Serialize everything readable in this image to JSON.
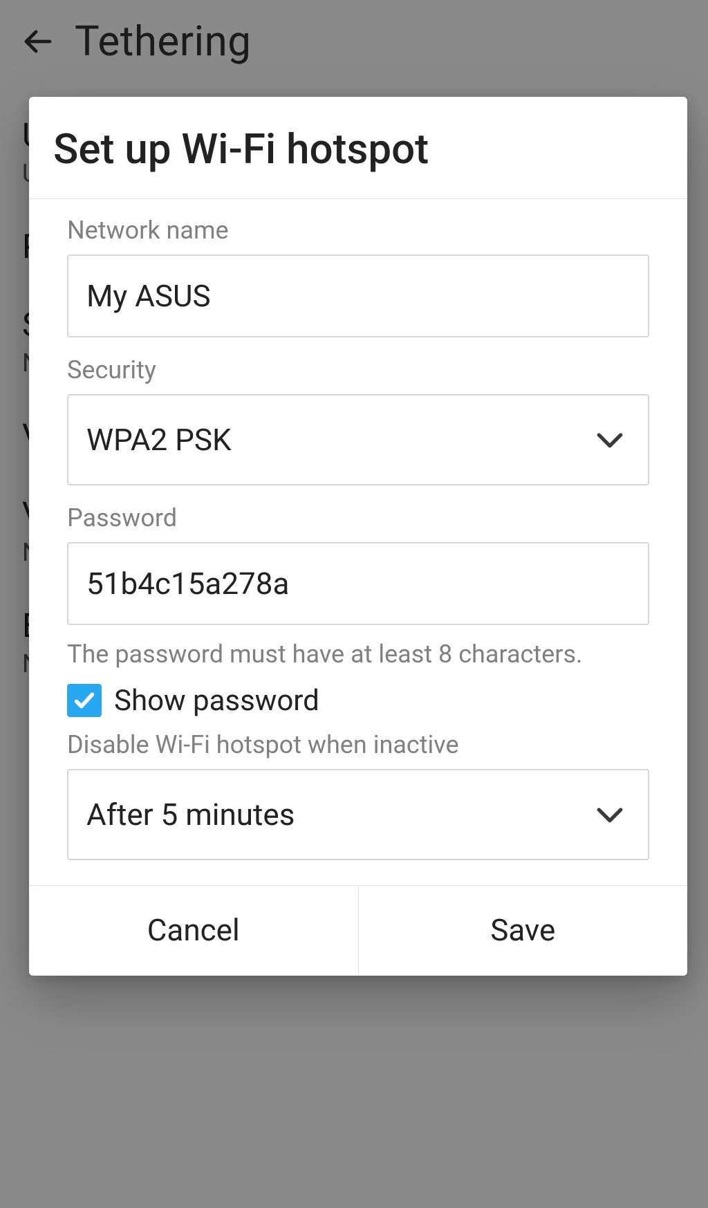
{
  "header": {
    "title": "Tethering"
  },
  "background_items": [
    {
      "title": "U",
      "sub": "U"
    },
    {
      "title": "P",
      "sub": ""
    },
    {
      "title": "S",
      "sub": "N"
    },
    {
      "title": "V",
      "sub": ""
    },
    {
      "title": "V",
      "sub": "N C"
    },
    {
      "title": "E",
      "sub": "N C"
    }
  ],
  "dialog": {
    "title": "Set up Wi-Fi hotspot",
    "network_name_label": "Network name",
    "network_name_value": "My ASUS",
    "security_label": "Security",
    "security_value": "WPA2 PSK",
    "password_label": "Password",
    "password_value": "51b4c15a278a",
    "password_helper": "The password must have at least 8 characters.",
    "show_password_label": "Show password",
    "show_password_checked": true,
    "inactive_label": "Disable Wi-Fi hotspot when inactive",
    "inactive_value": "After 5 minutes",
    "cancel": "Cancel",
    "save": "Save"
  }
}
